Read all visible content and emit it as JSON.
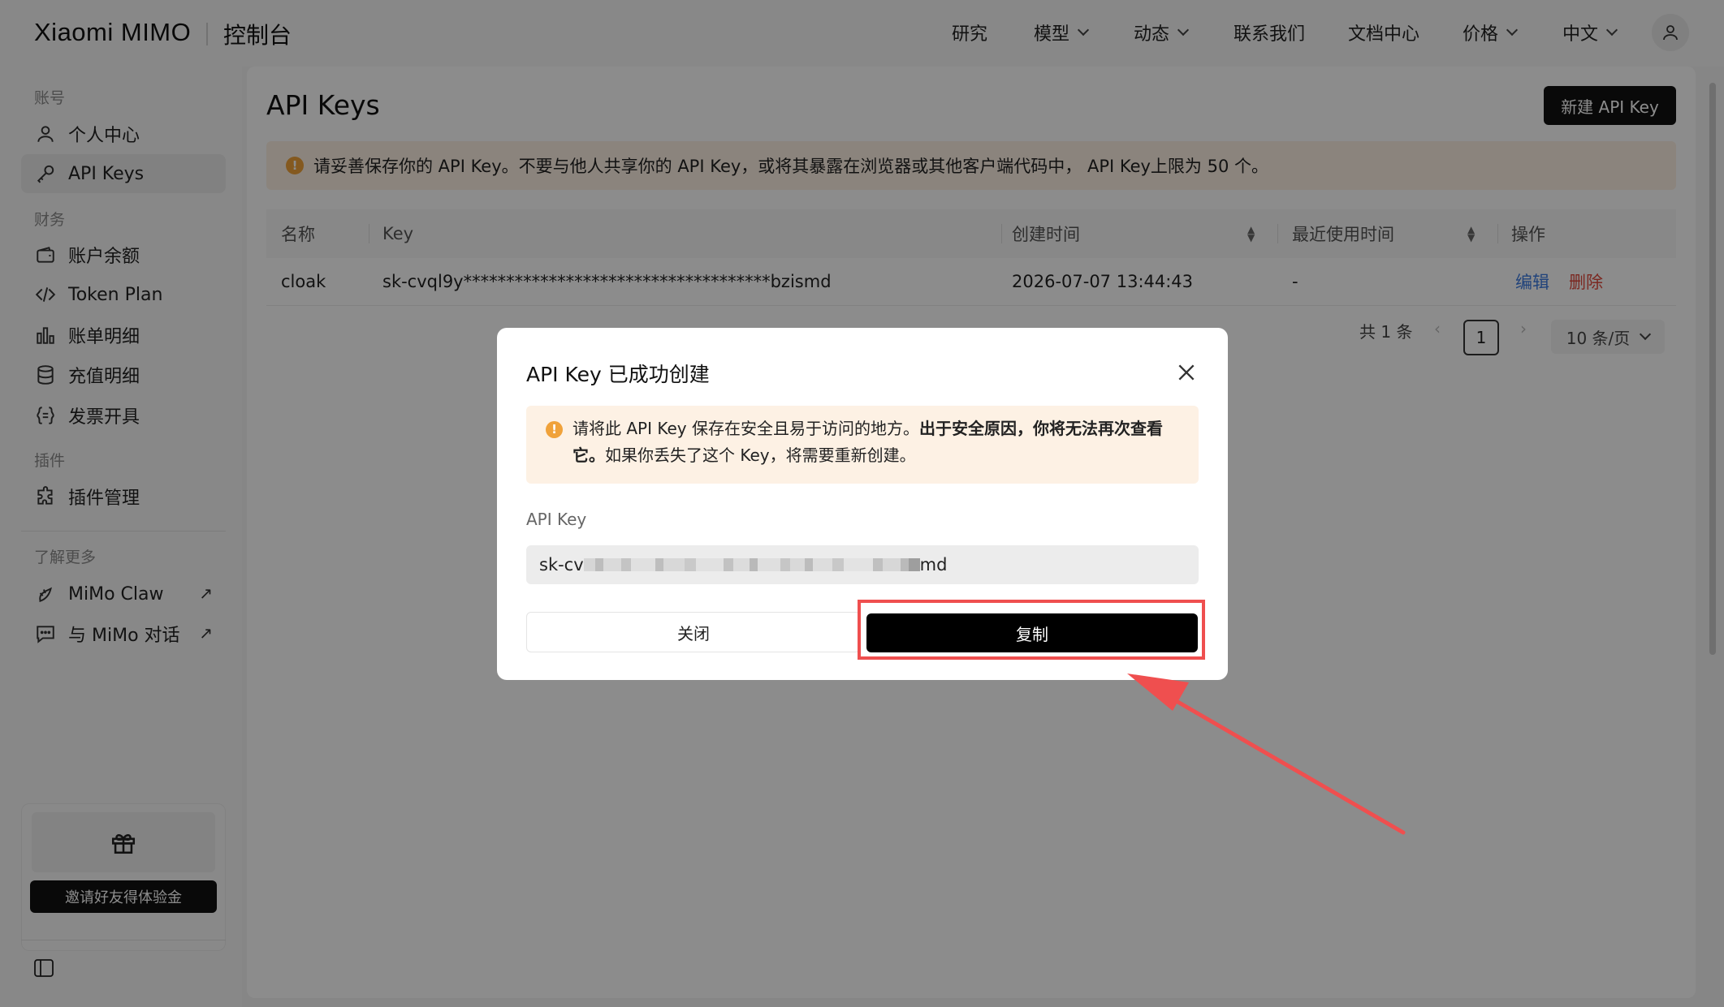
{
  "header": {
    "logo": "Xiaomi MIMO",
    "console": "控制台",
    "nav": [
      {
        "label": "研究",
        "has_dropdown": false
      },
      {
        "label": "模型",
        "has_dropdown": true
      },
      {
        "label": "动态",
        "has_dropdown": true
      },
      {
        "label": "联系我们",
        "has_dropdown": false
      },
      {
        "label": "文档中心",
        "has_dropdown": false
      },
      {
        "label": "价格",
        "has_dropdown": true
      },
      {
        "label": "中文",
        "has_dropdown": true
      }
    ]
  },
  "sidebar": {
    "sections": [
      {
        "label": "账号"
      },
      {
        "label": "财务"
      },
      {
        "label": "插件"
      },
      {
        "label": "了解更多"
      }
    ],
    "items": [
      {
        "label": "个人中心",
        "icon": "user-icon",
        "active": false
      },
      {
        "label": "API Keys",
        "icon": "key-icon",
        "active": true
      },
      {
        "label": "账户余额",
        "icon": "wallet-icon",
        "active": false
      },
      {
        "label": "Token Plan",
        "icon": "code-icon",
        "active": false
      },
      {
        "label": "账单明细",
        "icon": "bar-chart-icon",
        "active": false
      },
      {
        "label": "充值明细",
        "icon": "database-icon",
        "active": false
      },
      {
        "label": "发票开具",
        "icon": "braces-icon",
        "active": false
      },
      {
        "label": "插件管理",
        "icon": "puzzle-icon",
        "active": false
      },
      {
        "label": "MiMo Claw",
        "icon": "claw-icon",
        "external": "↗"
      },
      {
        "label": "与 MiMo 对话",
        "icon": "chat-icon",
        "external": "↗"
      }
    ],
    "invite_button": "邀请好友得体验金"
  },
  "main": {
    "title": "API Keys",
    "new_button": "新建 API Key",
    "warning": "请妥善保存你的 API Key。不要与他人共享你的 API Key，或将其暴露在浏览器或其他客户端代码中， API Key上限为 50 个。",
    "table": {
      "headers": [
        "名称",
        "Key",
        "创建时间",
        "最近使用时间",
        "操作"
      ],
      "rows": [
        {
          "name": "cloak",
          "key": "sk-cvql9y************************************bzismd",
          "created": "2026-07-07 13:44:43",
          "last_used": "-",
          "edit": "编辑",
          "delete": "删除"
        }
      ]
    },
    "pagination": {
      "total": "共 1 条",
      "current_page": "1",
      "page_size": "10 条/页"
    }
  },
  "modal": {
    "title": "API Key 已成功创建",
    "alert_part1": "请将此 API Key 保存在安全且易于访问的地方。",
    "alert_bold": "出于安全原因，你将无法再次查看它。",
    "alert_part2": "如果你丢失了这个 Key，将需要重新创建。",
    "field_label": "API Key",
    "key_prefix": "sk-cv",
    "key_suffix": "md",
    "close_button": "关闭",
    "copy_button": "复制"
  },
  "colors": {
    "accent": "#000000",
    "warning_bg": "#fdf1e4",
    "warning_icon": "#f0a23a",
    "edit_link": "#3c7be0",
    "delete_link": "#e0493c",
    "highlight_annotation": "#ef4f4f"
  }
}
